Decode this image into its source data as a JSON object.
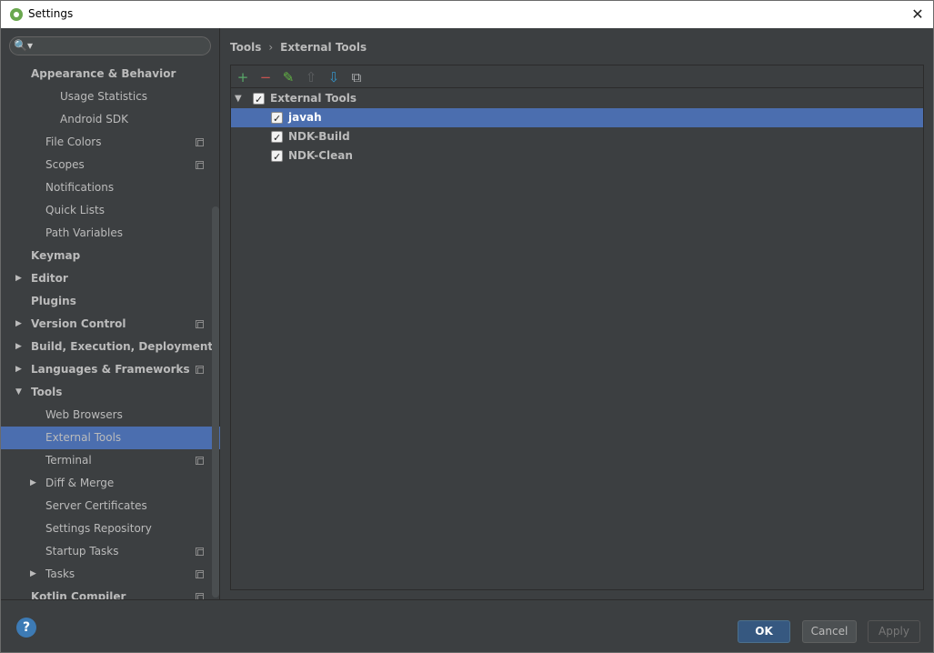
{
  "window": {
    "title": "Settings"
  },
  "search": {
    "placeholder": ""
  },
  "sidebar": {
    "items": [
      {
        "label": "Appearance & Behavior",
        "bold": true,
        "indent": 0,
        "arrow": "",
        "copy": false,
        "selected": false
      },
      {
        "label": "Usage Statistics",
        "bold": false,
        "indent": 2,
        "arrow": "",
        "copy": false,
        "selected": false
      },
      {
        "label": "Android SDK",
        "bold": false,
        "indent": 2,
        "arrow": "",
        "copy": false,
        "selected": false
      },
      {
        "label": "File Colors",
        "bold": false,
        "indent": 1,
        "arrow": "",
        "copy": true,
        "selected": false
      },
      {
        "label": "Scopes",
        "bold": false,
        "indent": 1,
        "arrow": "",
        "copy": true,
        "selected": false
      },
      {
        "label": "Notifications",
        "bold": false,
        "indent": 1,
        "arrow": "",
        "copy": false,
        "selected": false
      },
      {
        "label": "Quick Lists",
        "bold": false,
        "indent": 1,
        "arrow": "",
        "copy": false,
        "selected": false
      },
      {
        "label": "Path Variables",
        "bold": false,
        "indent": 1,
        "arrow": "",
        "copy": false,
        "selected": false
      },
      {
        "label": "Keymap",
        "bold": true,
        "indent": 0,
        "arrow": "",
        "copy": false,
        "selected": false
      },
      {
        "label": "Editor",
        "bold": true,
        "indent": 0,
        "arrow": "right",
        "copy": false,
        "selected": false
      },
      {
        "label": "Plugins",
        "bold": true,
        "indent": 0,
        "arrow": "",
        "copy": false,
        "selected": false
      },
      {
        "label": "Version Control",
        "bold": true,
        "indent": 0,
        "arrow": "right",
        "copy": true,
        "selected": false
      },
      {
        "label": "Build, Execution, Deployment",
        "bold": true,
        "indent": 0,
        "arrow": "right",
        "copy": false,
        "selected": false
      },
      {
        "label": "Languages & Frameworks",
        "bold": true,
        "indent": 0,
        "arrow": "right",
        "copy": true,
        "selected": false
      },
      {
        "label": "Tools",
        "bold": true,
        "indent": 0,
        "arrow": "down",
        "copy": false,
        "selected": false
      },
      {
        "label": "Web Browsers",
        "bold": false,
        "indent": 1,
        "arrow": "",
        "copy": false,
        "selected": false
      },
      {
        "label": "External Tools",
        "bold": false,
        "indent": 1,
        "arrow": "",
        "copy": false,
        "selected": true
      },
      {
        "label": "Terminal",
        "bold": false,
        "indent": 1,
        "arrow": "",
        "copy": true,
        "selected": false
      },
      {
        "label": "Diff & Merge",
        "bold": false,
        "indent": 1,
        "arrow": "right",
        "copy": false,
        "selected": false
      },
      {
        "label": "Server Certificates",
        "bold": false,
        "indent": 1,
        "arrow": "",
        "copy": false,
        "selected": false
      },
      {
        "label": "Settings Repository",
        "bold": false,
        "indent": 1,
        "arrow": "",
        "copy": false,
        "selected": false
      },
      {
        "label": "Startup Tasks",
        "bold": false,
        "indent": 1,
        "arrow": "",
        "copy": true,
        "selected": false
      },
      {
        "label": "Tasks",
        "bold": false,
        "indent": 1,
        "arrow": "right",
        "copy": true,
        "selected": false
      },
      {
        "label": "Kotlin Compiler",
        "bold": true,
        "indent": 0,
        "arrow": "",
        "copy": true,
        "selected": false
      }
    ]
  },
  "breadcrumb": {
    "parent": "Tools",
    "separator": "›",
    "current": "External Tools"
  },
  "toolbar": {
    "buttons": [
      {
        "name": "add-icon",
        "glyph": "+",
        "color": "#59a869",
        "enabled": true
      },
      {
        "name": "remove-icon",
        "glyph": "−",
        "color": "#c75450",
        "enabled": true
      },
      {
        "name": "edit-icon",
        "glyph": "✎",
        "color": "#62b543",
        "enabled": true
      },
      {
        "name": "move-up-icon",
        "glyph": "⇧",
        "color": "#5c5f61",
        "enabled": false
      },
      {
        "name": "move-down-icon",
        "glyph": "⇩",
        "color": "#3592c4",
        "enabled": true
      },
      {
        "name": "copy-icon",
        "glyph": "⧉",
        "color": "#afb1b3",
        "enabled": true
      }
    ]
  },
  "tools": {
    "group": {
      "label": "External Tools",
      "checked": true,
      "expanded": true
    },
    "items": [
      {
        "label": "javah",
        "checked": true,
        "selected": true
      },
      {
        "label": "NDK-Build",
        "checked": true,
        "selected": false
      },
      {
        "label": "NDK-Clean",
        "checked": true,
        "selected": false
      }
    ]
  },
  "footer": {
    "help_glyph": "?",
    "ok_label": "OK",
    "cancel_label": "Cancel",
    "apply_label": "Apply"
  },
  "colors": {
    "selection": "#4b6eaf",
    "background": "#3c3f41",
    "text": "#bbbbbb"
  }
}
